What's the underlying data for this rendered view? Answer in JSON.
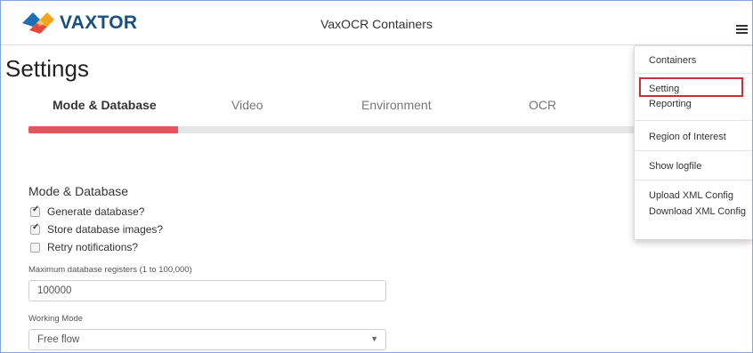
{
  "header": {
    "logo_text": "VAXTOR",
    "app_title": "VaxOCR Containers"
  },
  "page": {
    "title": "Settings"
  },
  "tabs": [
    {
      "label": "Mode & Database",
      "active": true
    },
    {
      "label": "Video",
      "active": false
    },
    {
      "label": "Environment",
      "active": false
    },
    {
      "label": "OCR",
      "active": false
    }
  ],
  "progress": {
    "fraction": 0.24,
    "fill_color": "#e0585e",
    "track_color": "#e6e6e6"
  },
  "form": {
    "section_title": "Mode & Database",
    "checkboxes": [
      {
        "label": "Generate database?",
        "checked": true
      },
      {
        "label": "Store database images?",
        "checked": true
      },
      {
        "label": "Retry notifications?",
        "checked": false
      }
    ],
    "max_registers": {
      "label": "Maximum database registers (1 to 100,000)",
      "value": "100000"
    },
    "working_mode": {
      "label": "Working Mode",
      "selected": "Free flow"
    }
  },
  "menu": {
    "items": [
      {
        "label": "Containers"
      },
      {
        "label": "Setting",
        "highlighted": true
      },
      {
        "label": "Reporting"
      },
      {
        "label": "Region of Interest"
      },
      {
        "label": "Show logfile"
      },
      {
        "label": "Upload XML Config"
      },
      {
        "label": "Download XML Config"
      }
    ],
    "highlight_color": "#c9303a"
  },
  "icons": {
    "logo": "vaxtor-logo-icon",
    "menu": "hamburger-menu-icon",
    "checkbox_tick": "checkmark-icon",
    "dropdown": "chevron-down-icon"
  }
}
